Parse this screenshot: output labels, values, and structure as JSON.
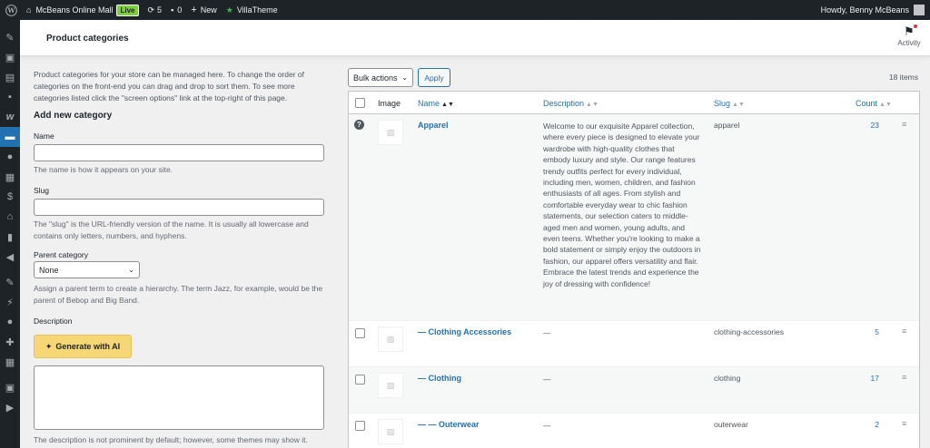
{
  "adminbar": {
    "site_name": "McBeans Online Mall",
    "live_label": "Live",
    "updates_count": "5",
    "comments_count": "0",
    "new_label": "New",
    "villatheme_label": "VillaTheme",
    "greeting": "Howdy, Benny McBeans"
  },
  "header": {
    "title": "Product categories",
    "activity_label": "Activity"
  },
  "form": {
    "intro": "Product categories for your store can be managed here. To change the order of categories on the front-end you can drag and drop to sort them. To see more categories listed click the \"screen options\" link at the top-right of this page.",
    "add_new_title": "Add new category",
    "name_label": "Name",
    "name_help": "The name is how it appears on your site.",
    "slug_label": "Slug",
    "slug_help": "The \"slug\" is the URL-friendly version of the name. It is usually all lowercase and contains only letters, numbers, and hyphens.",
    "parent_label": "Parent category",
    "parent_value": "None",
    "parent_help": "Assign a parent term to create a hierarchy. The term Jazz, for example, would be the parent of Bebop and Big Band.",
    "description_label": "Description",
    "ai_button": "Generate with AI",
    "description_help": "The description is not prominent by default; however, some themes may show it."
  },
  "toolbar": {
    "bulk_actions": "Bulk actions",
    "apply": "Apply",
    "items_count": "18 items"
  },
  "table": {
    "headers": {
      "image": "Image",
      "name": "Name",
      "description": "Description",
      "slug": "Slug",
      "count": "Count"
    },
    "rows": [
      {
        "name": "Apparel",
        "description": "Welcome to our exquisite Apparel collection, where every piece is designed to elevate your wardrobe with high-quality clothes that embody luxury and style. Our range features trendy outfits perfect for every individual, including men, women, children, and fashion enthusiasts of all ages. From stylish and comfortable everyday wear to chic fashion statements, our selection caters to middle-aged men and women, young adults, and even teens. Whether you're looking to make a bold statement or simply enjoy the outdoors in fashion, our apparel offers versatility and flair. Embrace the latest trends and experience the joy of dressing with confidence!",
        "slug": "apparel",
        "count": "23"
      },
      {
        "name": "— Clothing Accessories",
        "description": "—",
        "slug": "clothing-accessories",
        "count": "5"
      },
      {
        "name": "— Clothing",
        "description": "—",
        "slug": "clothing",
        "count": "17"
      },
      {
        "name": "— — Outerwear",
        "description": "—",
        "slug": "outerwear",
        "count": "2"
      }
    ]
  },
  "colors": {
    "adminbar_bg": "#1d2327",
    "accent": "#2271b1",
    "ai_button_bg": "#f6d776",
    "live_badge": "#7ad03a"
  }
}
